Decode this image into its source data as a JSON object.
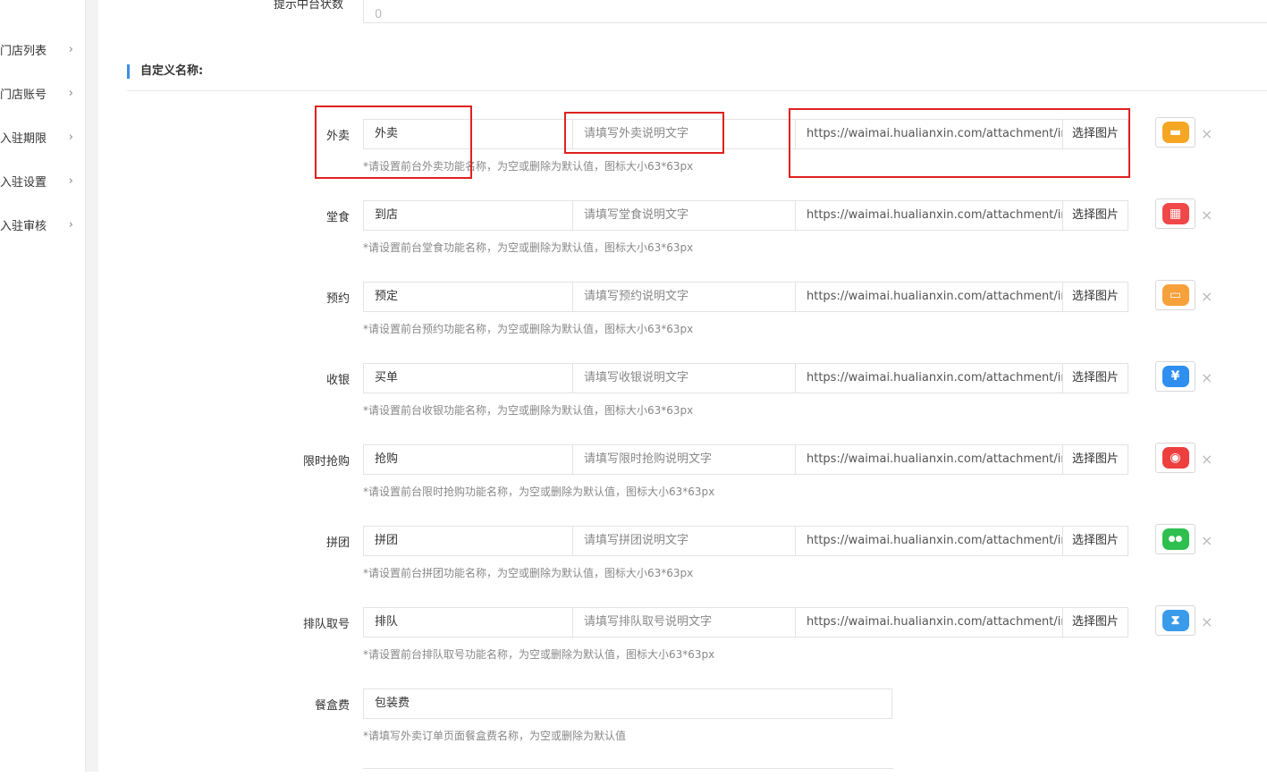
{
  "sidebar": {
    "items": [
      {
        "label": "门店列表"
      },
      {
        "label": "门店账号"
      },
      {
        "label": "入驻期限"
      },
      {
        "label": "入驻设置"
      },
      {
        "label": "入驻审核"
      }
    ],
    "chevron": "›"
  },
  "top_field": {
    "label": "提示中台状数",
    "value": "0"
  },
  "section": {
    "title": "自定义名称:"
  },
  "rows": [
    {
      "label": "外卖",
      "name": "外卖",
      "desc_placeholder": "请填写外卖说明文字",
      "url": "https://waimai.hualianxin.com/attachment/images/",
      "button": "选择图片",
      "help": "*请设置前台外卖功能名称，为空或删除为默认值，图标大小63*63px",
      "icon": "food-tray-icon",
      "icon_color": "#f5a623",
      "glyph": "▬"
    },
    {
      "label": "堂食",
      "name": "到店",
      "desc_placeholder": "请填写堂食说明文字",
      "url": "https://waimai.hualianxin.com/attachment/images/",
      "button": "选择图片",
      "help": "*请设置前台堂食功能名称，为空或删除为默认值，图标大小63*63px",
      "icon": "storefront-icon",
      "icon_color": "#f04848",
      "glyph": "▦"
    },
    {
      "label": "预约",
      "name": "预定",
      "desc_placeholder": "请填写预约说明文字",
      "url": "https://waimai.hualianxin.com/attachment/images/",
      "button": "选择图片",
      "help": "*请设置前台预约功能名称，为空或删除为默认值，图标大小63*63px",
      "icon": "calendar-icon",
      "icon_color": "#f7a13a",
      "glyph": "▭"
    },
    {
      "label": "收银",
      "name": "买单",
      "desc_placeholder": "请填写收银说明文字",
      "url": "https://waimai.hualianxin.com/attachment/images/",
      "button": "选择图片",
      "help": "*请设置前台收银功能名称，为空或删除为默认值，图标大小63*63px",
      "icon": "yen-icon",
      "icon_color": "#2f8ff0",
      "glyph": "¥"
    },
    {
      "label": "限时抢购",
      "name": "抢购",
      "desc_placeholder": "请填写限时抢购说明文字",
      "url": "https://waimai.hualianxin.com/attachment/images/",
      "button": "选择图片",
      "help": "*请设置前台限时抢购功能名称，为空或删除为默认值，图标大小63*63px",
      "icon": "alarm-clock-icon",
      "icon_color": "#ee3f3f",
      "glyph": "◉"
    },
    {
      "label": "拼团",
      "name": "拼团",
      "desc_placeholder": "请填写拼团说明文字",
      "url": "https://waimai.hualianxin.com/attachment/images/",
      "button": "选择图片",
      "help": "*请设置前台拼团功能名称，为空或删除为默认值，图标大小63*63px",
      "icon": "group-users-icon",
      "icon_color": "#2fbf4f",
      "glyph": "●●"
    },
    {
      "label": "排队取号",
      "name": "排队",
      "desc_placeholder": "请填写排队取号说明文字",
      "url": "https://waimai.hualianxin.com/attachment/images/",
      "button": "选择图片",
      "help": "*请设置前台排队取号功能名称，为空或删除为默认值，图标大小63*63px",
      "icon": "hourglass-icon",
      "icon_color": "#3a9bea",
      "glyph": "⧗"
    }
  ],
  "delete_glyph": "×",
  "fee": {
    "label": "餐盒费",
    "value": "包装费",
    "help": "*请填写外卖订单页面餐盒费名称，为空或删除为默认值"
  }
}
